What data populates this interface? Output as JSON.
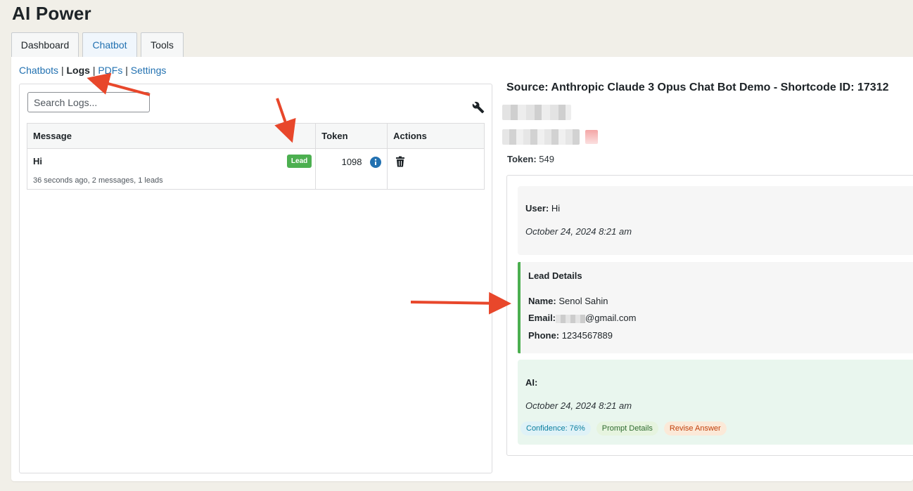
{
  "app": {
    "title": "AI Power"
  },
  "tabs": [
    {
      "label": "Dashboard",
      "active": false
    },
    {
      "label": "Chatbot",
      "active": true
    },
    {
      "label": "Tools",
      "active": false
    }
  ],
  "subnav": {
    "chatbots": "Chatbots",
    "logs": "Logs",
    "pdfs": "PDFs",
    "settings": "Settings",
    "separator": "|"
  },
  "logs_panel": {
    "search_placeholder": "Search Logs...",
    "columns": {
      "message": "Message",
      "token": "Token",
      "actions": "Actions"
    },
    "rows": [
      {
        "title": "Hi",
        "meta": "36 seconds ago, 2 messages, 1 leads",
        "badge": "Lead",
        "token": "1098"
      }
    ]
  },
  "detail": {
    "source": "Source: Anthropic Claude 3 Opus Chat Bot Demo - Shortcode ID: 17312",
    "token_label": "Token:",
    "token_value": "549",
    "user": {
      "label": "User:",
      "text": "Hi",
      "timestamp": "October 24, 2024 8:21 am"
    },
    "lead": {
      "heading": "Lead Details",
      "name_label": "Name:",
      "name": "Senol Sahin",
      "email_label": "Email:",
      "email": "@gmail.com",
      "phone_label": "Phone:",
      "phone": "1234567889"
    },
    "ai": {
      "label": "AI:",
      "timestamp": "October 24, 2024 8:21 am",
      "confidence": "Confidence: 76%",
      "prompt_details": "Prompt Details",
      "revise": "Revise Answer"
    }
  },
  "colors": {
    "accent": "#2271b1",
    "lead_green": "#4caf50",
    "annotation_arrow": "#e8472b"
  },
  "icons": {
    "wrench": "wrench-icon",
    "info": "info-icon",
    "trash": "trash-icon"
  }
}
